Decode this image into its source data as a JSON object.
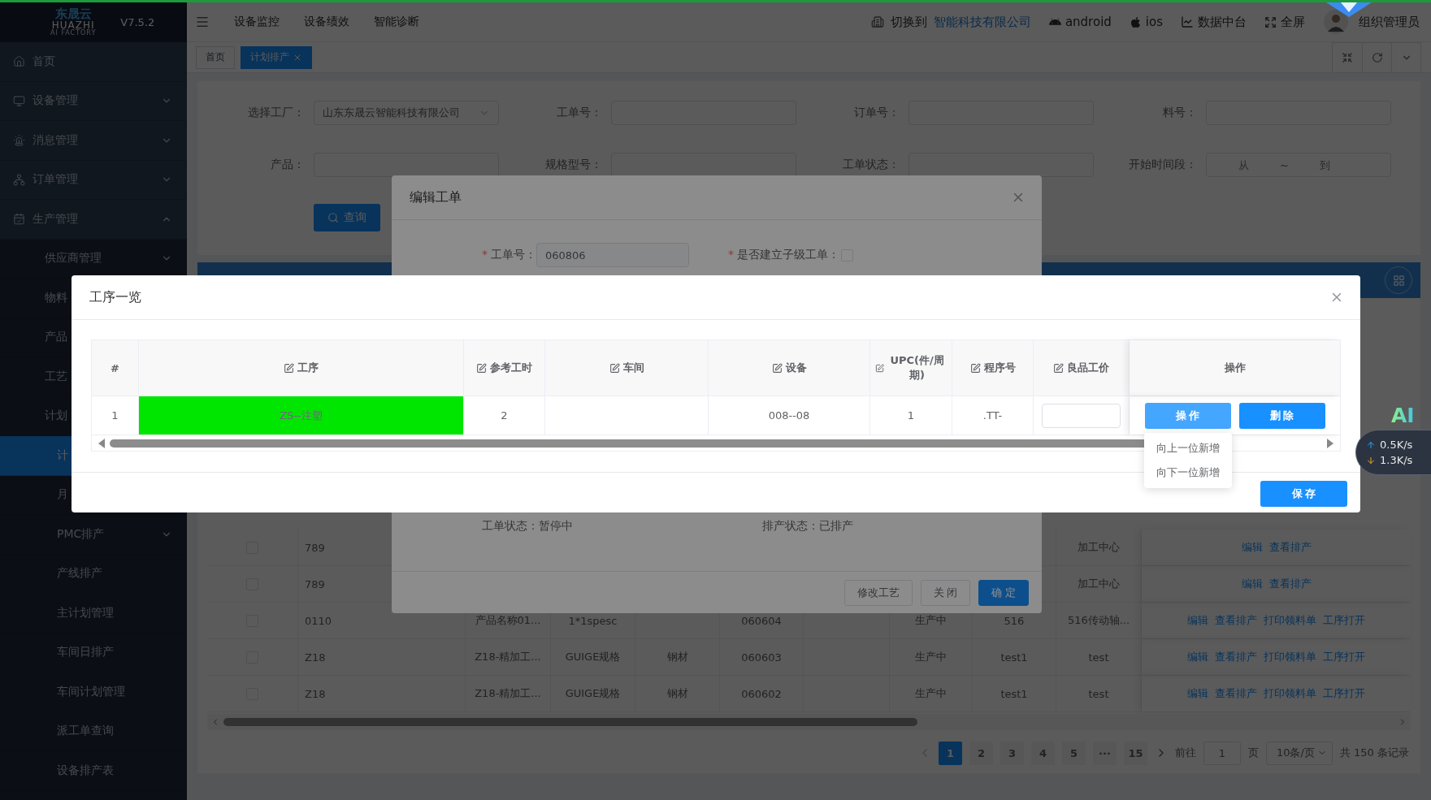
{
  "header": {
    "logo": {
      "name": "东晟云",
      "brand": "HUAZHI",
      "tagline": "AI FACTORY"
    },
    "version": "V7.5.2",
    "nav": [
      "设备监控",
      "设备绩效",
      "智能诊断"
    ],
    "switch_label": "切换到",
    "company": "智能科技有限公司",
    "tools": [
      {
        "kind": "android",
        "label": "android"
      },
      {
        "kind": "apple",
        "label": "ios"
      },
      {
        "kind": "chart",
        "label": "数据中台"
      },
      {
        "kind": "fullscreen",
        "label": "全屏"
      }
    ],
    "user": "组织管理员"
  },
  "sidebar": {
    "items": [
      {
        "label": "首页",
        "selected": false
      },
      {
        "label": "设备管理",
        "selected": false,
        "expanded": false
      },
      {
        "label": "消息管理",
        "selected": false,
        "expanded": false
      },
      {
        "label": "订单管理",
        "selected": false,
        "expanded": false
      },
      {
        "label": "生产管理",
        "selected": false,
        "expanded": true,
        "children": [
          {
            "label": "供应商管理",
            "selected": false,
            "expanded": false
          },
          {
            "label": "物料",
            "selected": false
          },
          {
            "label": "产品",
            "selected": false
          },
          {
            "label": "工艺",
            "selected": false
          },
          {
            "label": "计划",
            "selected": false,
            "children": [
              {
                "label": "计",
                "selected": true
              },
              {
                "label": "月",
                "selected": false
              },
              {
                "label": "PMC排产",
                "selected": false,
                "expanded": false
              },
              {
                "label": "产线排产",
                "selected": false
              },
              {
                "label": "主计划管理",
                "selected": false
              },
              {
                "label": "车间日排产",
                "selected": false
              },
              {
                "label": "车间计划管理",
                "selected": false
              },
              {
                "label": "派工单查询",
                "selected": false
              },
              {
                "label": "设备排产表",
                "selected": false
              }
            ]
          }
        ]
      }
    ]
  },
  "tabs": [
    {
      "label": "首页",
      "selected": false,
      "closable": false
    },
    {
      "label": "计划排产",
      "selected": true,
      "closable": true
    }
  ],
  "search": {
    "fields": [
      {
        "kind": "select",
        "label": "选择工厂：",
        "value": "山东东晟云智能科技有限公司"
      },
      {
        "kind": "input",
        "label": "工单号："
      },
      {
        "kind": "input",
        "label": "订单号："
      },
      {
        "kind": "input",
        "label": "料号："
      },
      {
        "kind": "input",
        "label": "产品："
      },
      {
        "kind": "input",
        "label": "规格型号："
      },
      {
        "kind": "input",
        "label": "工单状态："
      },
      {
        "kind": "range",
        "label": "开始时间段：",
        "start": {
          "placeholder": "从"
        },
        "separator": "~",
        "end": {
          "placeholder": "到"
        }
      }
    ],
    "button": "查询"
  },
  "table": {
    "rows": [
      {
        "checked": false,
        "column_1": "789",
        "column_9": "加工中心",
        "actions": [
          "编辑",
          "查看排产"
        ]
      },
      {
        "checked": false,
        "column_1": "789",
        "column_9": "加工中心",
        "actions": [
          "编辑",
          "查看排产"
        ]
      },
      {
        "checked": false,
        "column_1": "0110",
        "column_2": "产品名称01...",
        "column_3": "1*1spesc",
        "column_5": "060604",
        "column_7": "生产中",
        "column_8": "516",
        "column_9": "516传动轴...",
        "actions": [
          "编辑",
          "查看排产",
          "打印领料单",
          "工序打开"
        ]
      },
      {
        "checked": false,
        "column_1": "Z18",
        "column_2": "Z18-精加工...",
        "column_3": "GUIGE规格",
        "column_4": "钢材",
        "column_5": "060603",
        "column_7": "生产中",
        "column_8": "test1",
        "column_9": "test",
        "actions": [
          "编辑",
          "查看排产",
          "打印领料单",
          "工序打开"
        ]
      },
      {
        "checked": false,
        "column_1": "Z18",
        "column_2": "Z18-精加工...",
        "column_3": "GUIGE规格",
        "column_4": "钢材",
        "column_5": "060602",
        "column_7": "生产中",
        "column_8": "test1",
        "column_9": "test",
        "actions": [
          "编辑",
          "查看排产",
          "打印领料单",
          "工序打开"
        ]
      }
    ]
  },
  "pagination": {
    "pages": [
      {
        "label": "1",
        "selected": true
      },
      {
        "label": "2",
        "selected": false
      },
      {
        "label": "3",
        "selected": false
      },
      {
        "label": "4",
        "selected": false
      },
      {
        "label": "5",
        "selected": false
      },
      {
        "label": "···",
        "selected": false
      },
      {
        "label": "15",
        "selected": false
      }
    ],
    "goto_label": "前往",
    "goto_value": "1",
    "page_unit": "页",
    "page_size": "10条/页",
    "total": "共 150 条记录"
  },
  "edit_dialog": {
    "title": "编辑工单",
    "fields": [
      {
        "kind": "input",
        "required_mark": "*",
        "label": "工单号：",
        "value": "060806"
      },
      {
        "kind": "checkbox",
        "required_mark": "*",
        "label": "是否建立子级工单：",
        "checked": false
      }
    ],
    "info": [
      "工单状态：暂停中",
      "排产状态：已排产"
    ],
    "buttons": [
      {
        "label": "修改工艺",
        "kind": "default"
      },
      {
        "label": "关 闭",
        "kind": "default"
      },
      {
        "label": "确 定",
        "kind": "primary"
      }
    ]
  },
  "process_dialog": {
    "title": "工序一览",
    "columns": [
      {
        "label": "#",
        "editable": false
      },
      {
        "label": "工序",
        "editable": true
      },
      {
        "label": "参考工时",
        "editable": true
      },
      {
        "label": "车间",
        "editable": true
      },
      {
        "label": "设备",
        "editable": true
      },
      {
        "label": "UPC(件/周期)",
        "editable": true
      },
      {
        "label": "程序号",
        "editable": true
      },
      {
        "label": "良品工价",
        "editable": true
      },
      {
        "label": "操作",
        "editable": false
      }
    ],
    "rows": [
      {
        "index": "1",
        "process": "ZS--注塑",
        "highlighted": true,
        "hours": "2",
        "equipment": "008--08",
        "upc": "1",
        "program": ".TT-",
        "actions": [
          {
            "label": "操 作",
            "kind": "menu",
            "open": true
          },
          {
            "label": "删 除",
            "kind": "delete"
          }
        ],
        "menu_items": [
          "向上一位新增",
          "向下一位新增"
        ]
      }
    ],
    "save": "保 存"
  },
  "widget": {
    "badge": "AI",
    "upload": "0.5K/s",
    "download": "1.3K/s"
  }
}
